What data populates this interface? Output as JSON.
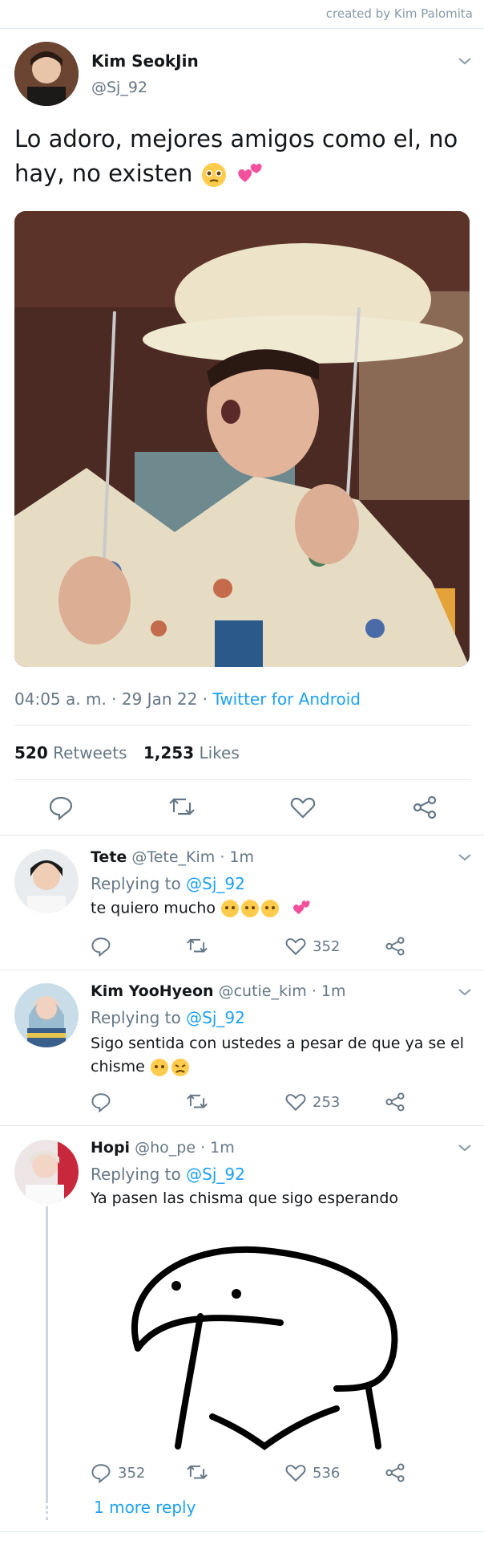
{
  "credit": "created by Kim Palomita",
  "main": {
    "name": "Kim SeokJin",
    "handle": "@Sj_92",
    "text": "Lo adoro, mejores amigos como el, no hay, no existen",
    "meta_time": "04:05 a. m. · 29 Jan 22 · ",
    "meta_source": "Twitter for Android",
    "retweets_count": "520",
    "retweets_label": "Retweets",
    "likes_count": "1,253",
    "likes_label": "Likes"
  },
  "replies": [
    {
      "name": "Tete",
      "handle": "@Tete_Kim · 1m",
      "replying": "Replying to ",
      "to": "@Sj_92",
      "text": "te quiero mucho",
      "likes": "352"
    },
    {
      "name": "Kim YooHyeon",
      "handle": "@cutie_kim · 1m",
      "replying": "Replying to ",
      "to": "@Sj_92",
      "text": "Sigo sentida con ustedes a pesar de que ya se el chisme",
      "likes": "253"
    },
    {
      "name": "Hopi",
      "handle": "@ho_pe · 1m",
      "replying": "Replying to ",
      "to": "@Sj_92",
      "text": "Ya pasen las chisma que sigo esperando",
      "replies": "352",
      "likes": "536"
    }
  ],
  "more_reply": "1 more reply",
  "colors": {
    "accent": "#1da1f2",
    "muted": "#657786",
    "divider": "#e1e8ed"
  }
}
